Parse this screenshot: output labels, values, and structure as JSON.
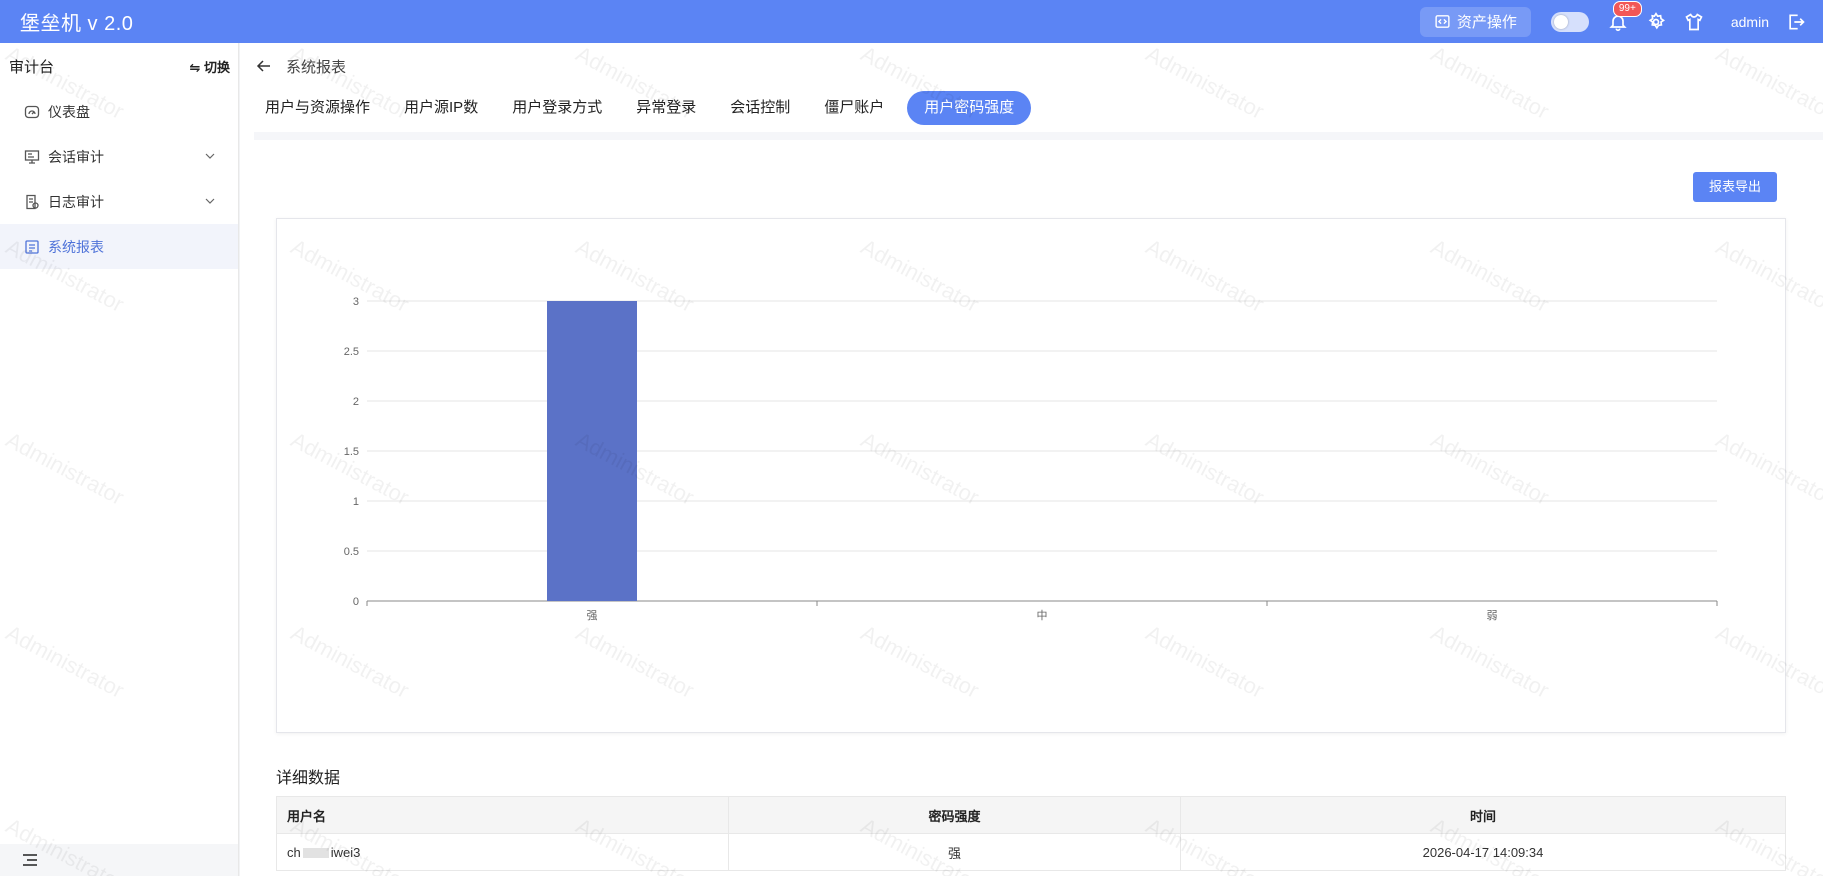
{
  "app": {
    "title": "堡垒机 v 2.0"
  },
  "header": {
    "asset_button": "资产操作",
    "notification_badge": "99+",
    "username": "admin"
  },
  "sidebar": {
    "title": "审计台",
    "switch_label": "⇋ 切换",
    "items": [
      {
        "label": "仪表盘",
        "icon": "dashboard-icon",
        "expandable": false,
        "active": false
      },
      {
        "label": "会话审计",
        "icon": "monitor-icon",
        "expandable": true,
        "active": false
      },
      {
        "label": "日志审计",
        "icon": "log-icon",
        "expandable": true,
        "active": false
      },
      {
        "label": "系统报表",
        "icon": "report-icon",
        "expandable": false,
        "active": true
      }
    ]
  },
  "breadcrumb": {
    "title": "系统报表"
  },
  "tabs": [
    {
      "label": "用户与资源操作",
      "active": false
    },
    {
      "label": "用户源IP数",
      "active": false
    },
    {
      "label": "用户登录方式",
      "active": false
    },
    {
      "label": "异常登录",
      "active": false
    },
    {
      "label": "会话控制",
      "active": false
    },
    {
      "label": "僵尸账户",
      "active": false
    },
    {
      "label": "用户密码强度",
      "active": true
    }
  ],
  "export_button": "报表导出",
  "watermark": "Administrator",
  "chart_data": {
    "type": "bar",
    "categories": [
      "强",
      "中",
      "弱"
    ],
    "values": [
      3,
      0,
      0
    ],
    "ylim": [
      0,
      3
    ],
    "yticks": [
      "0",
      "0.5",
      "1",
      "1.5",
      "2",
      "2.5",
      "3"
    ],
    "grid": true,
    "bar_color": "#5b72c7"
  },
  "details": {
    "title": "详细数据",
    "columns": [
      "用户名",
      "密码强度",
      "时间"
    ],
    "rows": [
      {
        "user_prefix": "ch",
        "user_suffix": "iwei3",
        "strength": "强",
        "time": "2026-04-17 14:09:34"
      }
    ]
  },
  "colors": {
    "primary": "#5b84f4",
    "active_menu_text": "#4f73d9"
  }
}
